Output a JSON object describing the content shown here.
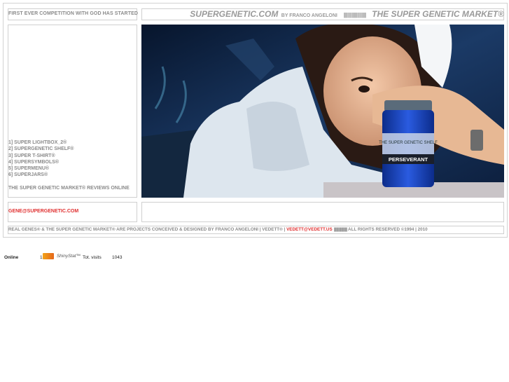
{
  "header": {
    "tagline": "FIRST EVER COMPETITION WITH GOD HAS STARTED",
    "site_name": "SUPERGENETIC.COM",
    "by_line": "BY FRANCO ANGELONI",
    "bars": "||||||||||||||||||||||||||||||",
    "market_title": "THE SUPER GENETIC MARKET®"
  },
  "menu": {
    "items": [
      "1] SUPER LIGHTBOX_2®",
      "2] SUPERGENETIC SHELF®",
      "3] SUPER T-SHIRT®",
      "4] SUPERSYMBOLS®",
      "5] SUPERMENU®",
      "6] SUPERJARS®"
    ],
    "reviews": "THE SUPER GENETIC MARKET® REVIEWS ONLINE"
  },
  "contact": {
    "email": "GENE@SUPERGENETIC.COM"
  },
  "photo": {
    "jar_label_top": "THE SUPER GENETIC SHELF",
    "jar_label_main": "PERSEVERANT"
  },
  "footer": {
    "text": "REAL GENES® & THE SUPER GENETIC MARKET® ARE PROJECTS CONCEIVED & DESIGNED BY FRANCO ANGELONI | VEDETT® |",
    "email": "VEDETT@VEDETT.US",
    "bars": "||||||||||||||||||||||||||||||",
    "rights": "ALL RIGHTS RESERVED ©1994 | 2010"
  },
  "stats": {
    "online_label": "Online",
    "online_count": "1",
    "brand": "ShinyStat™",
    "visits_label": "Tot. visits",
    "visits_count": "1043"
  },
  "colors": {
    "accent_red": "#e03030",
    "text_grey": "#8a8a8a",
    "border": "#cfcfcf"
  }
}
